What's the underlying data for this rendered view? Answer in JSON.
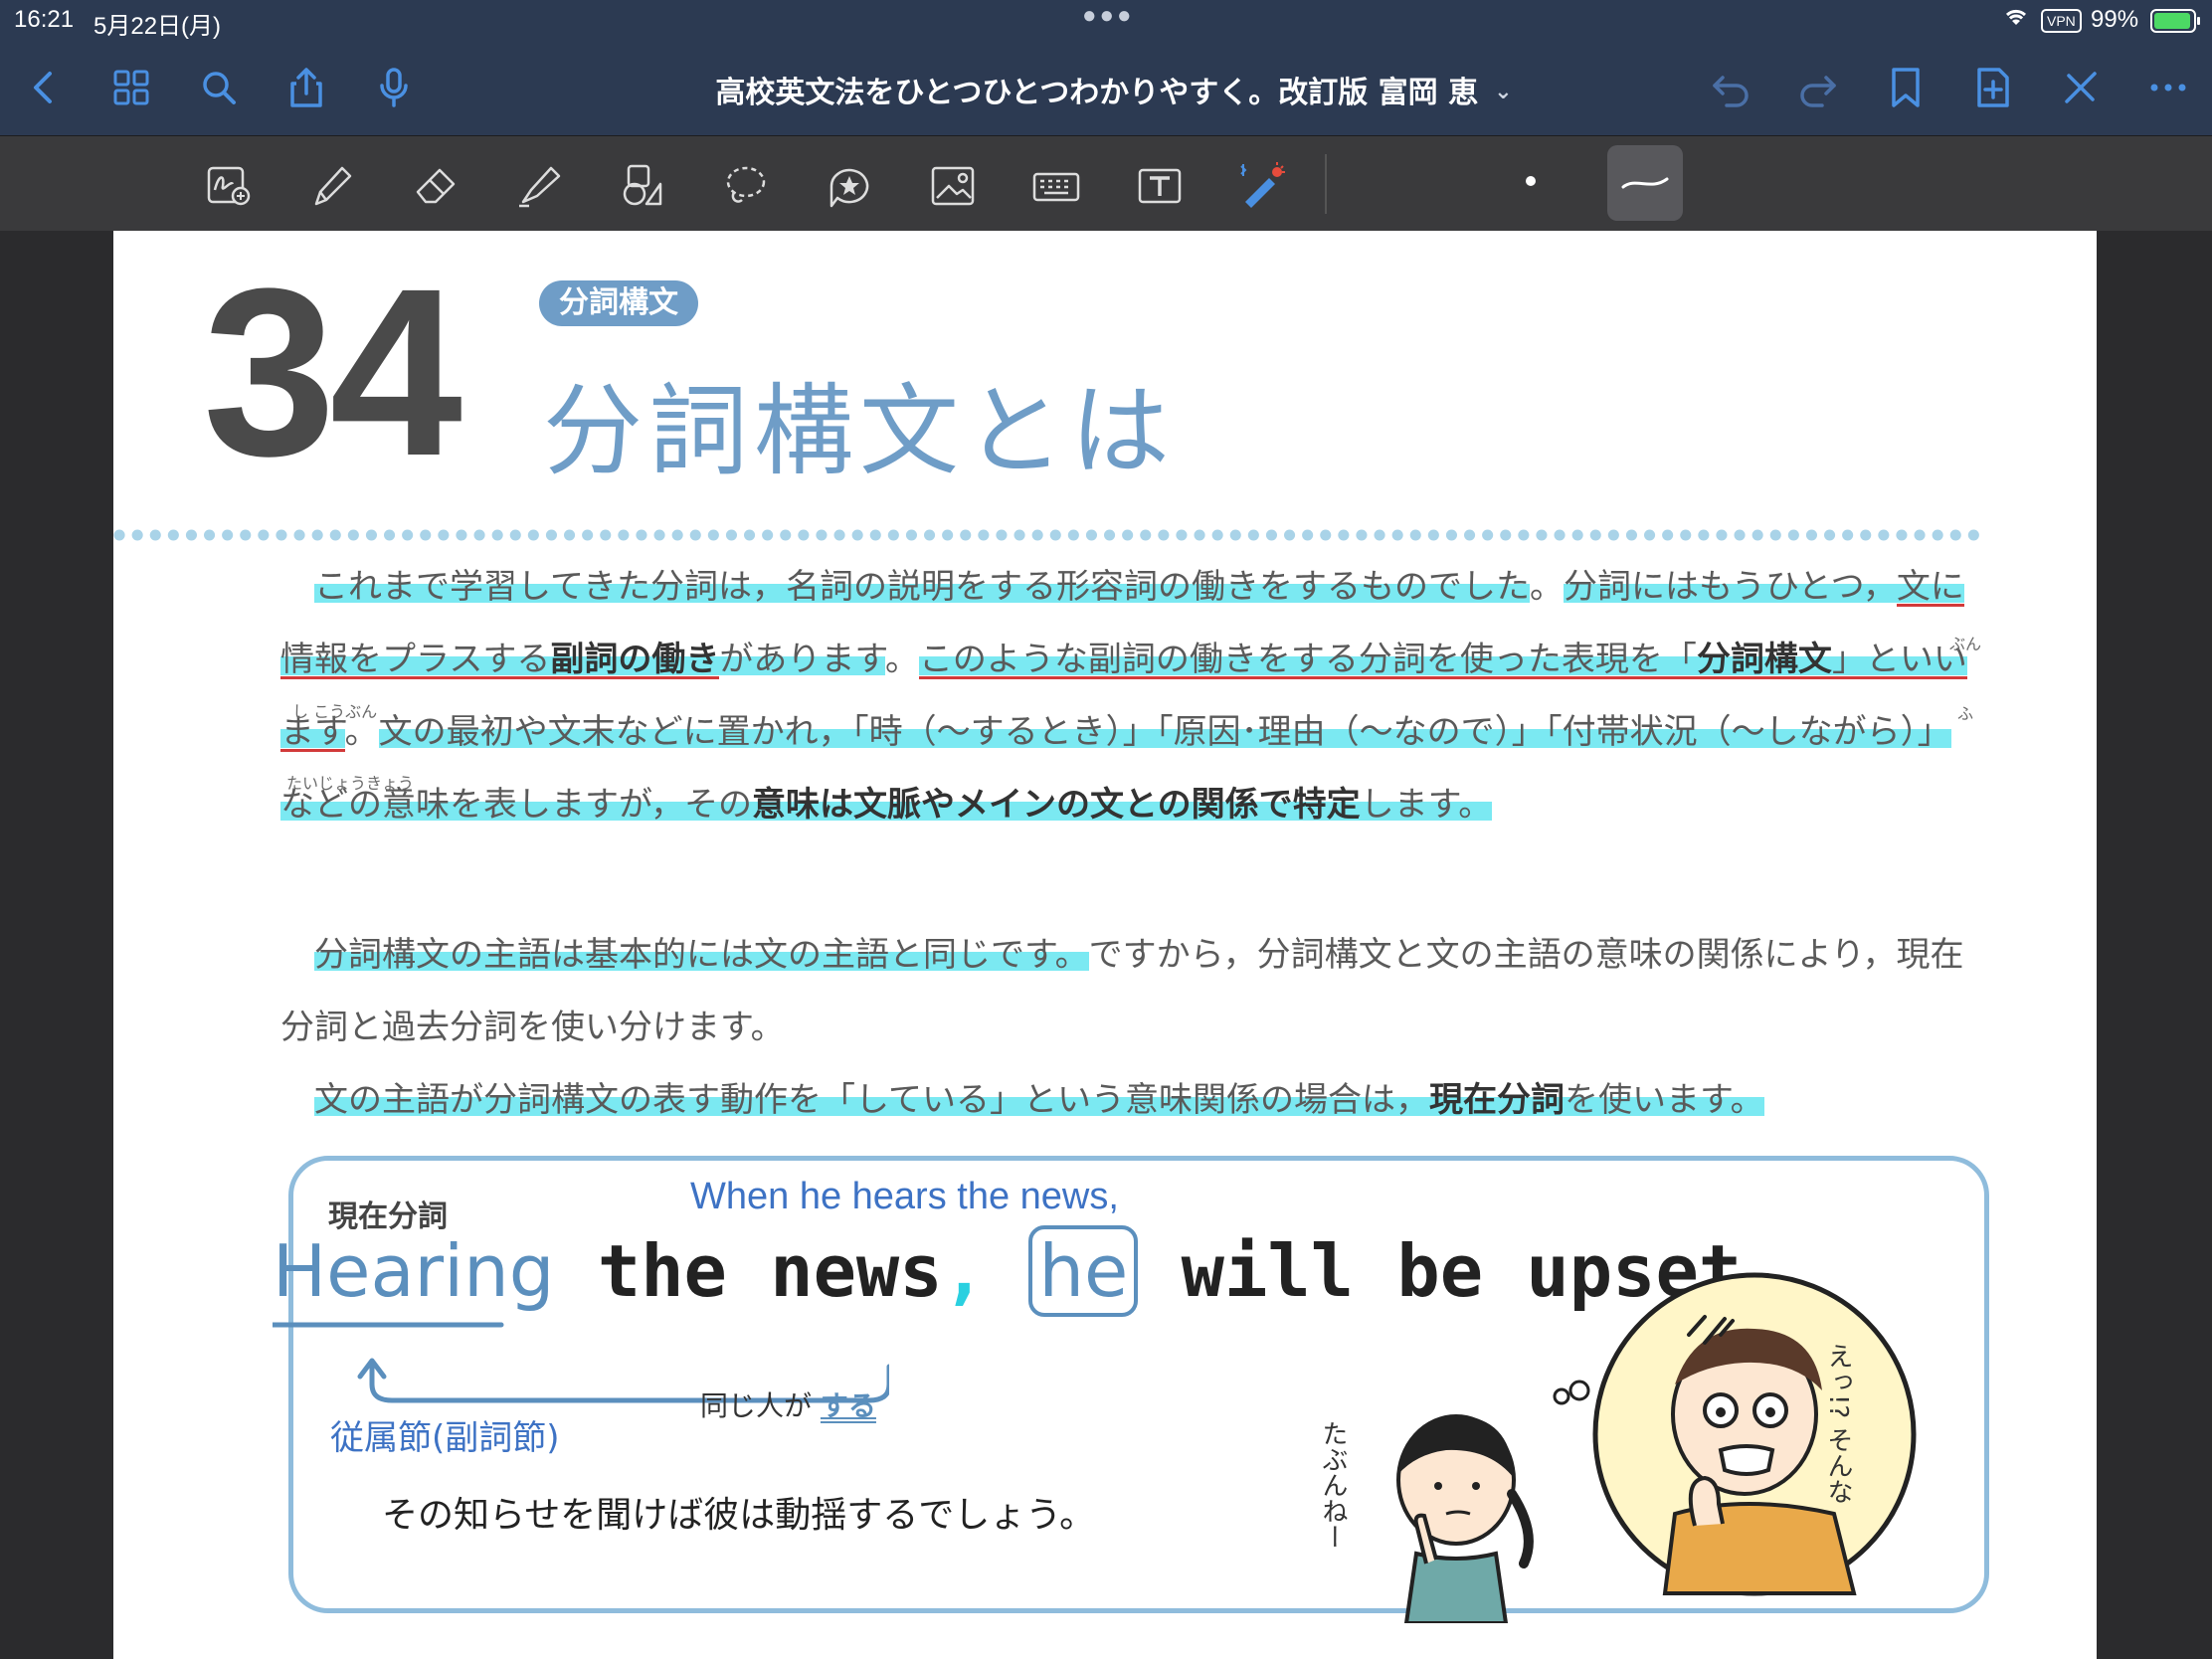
{
  "status": {
    "time": "16:21",
    "date": "5月22日(月)",
    "vpn": "VPN",
    "battery": "99%"
  },
  "nav": {
    "title": "高校英文法をひとつひとつわかりやすく。改訂版 富岡 恵"
  },
  "book": {
    "chapter_number": "34",
    "section_tag": "分詞構文",
    "chapter_title": "分詞構文とは",
    "para1": {
      "s1": "これまで学習してきた分詞は，名詞の説明をする形容詞の働きをするものでした",
      "s1_end": "。",
      "s2a": "分詞にはもうひとつ，",
      "s2b": "文に情報をプラスする",
      "s2c": "副詞の働き",
      "s2d": "があります",
      "s2_end": "。",
      "s3a": "このような副詞の働きをする分詞を使った表現を「",
      "s3b": "分詞構文",
      "s3c": "」といいます",
      "s3_end": "。",
      "s4a": "文の最初や文末などに置かれ，「時（～するとき）」「原因･理由（～なので）」「付帯状況（～しながら）」などの意味を表しますが，その",
      "s4b": "意味は文脈やメインの文との関係で特定",
      "s4c": "します。"
    },
    "ruby": {
      "bun": "ぶん",
      "shikoubun": "し こうぶん",
      "fu": "ふ",
      "taijoukyou": "たいじょうきょう"
    },
    "para2": {
      "s1": "分詞構文の主語は基本的には文の主語と同じです。",
      "s2": "ですから，分詞構文と文の主語の意味の関係により，現在分詞と過去分詞を使い分けます。"
    },
    "para3": {
      "s1": "文の主語が分詞構文の表す動作を「している」という意味関係の場合は，",
      "s2": "現在分詞",
      "s3": "を使います。"
    },
    "example": {
      "label_present_participle": "現在分詞",
      "translation_en": "When he hears the news,",
      "word_hearing": "Hearing",
      "word_the_news": " the news",
      "comma": ",",
      "word_he": "he",
      "word_rest": " will be upset.",
      "same_subject": "同じ人が",
      "suru": "する",
      "sub_clause": "従属節(副詞節)",
      "japanese": "その知らせを聞けば彼は動揺するでしょう。",
      "bubble_girl": "たぶんねー",
      "bubble_man": "えっ!? そんな",
      "girl_thought": "oo"
    }
  }
}
